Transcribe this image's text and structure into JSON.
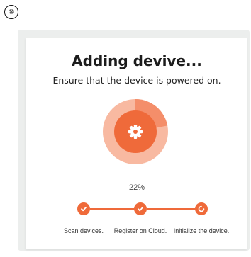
{
  "badge": {
    "number": "⑩"
  },
  "dialog": {
    "title": "Adding devive...",
    "subtitle": "Ensure that the device is powered on."
  },
  "progress": {
    "percent_label": "22%",
    "value": 22
  },
  "steps": [
    {
      "label": "Scan devices.",
      "state": "done",
      "icon": "check-icon"
    },
    {
      "label": "Register on Cloud.",
      "state": "done",
      "icon": "check-icon"
    },
    {
      "label": "Initialize the device.",
      "state": "in-progress",
      "icon": "spinner-icon"
    }
  ],
  "colors": {
    "accent": "#ef6a3a",
    "accent_light": "#f8b9a1",
    "accent_mid": "#f48e6a"
  },
  "icons": {
    "center": "gear-icon"
  }
}
